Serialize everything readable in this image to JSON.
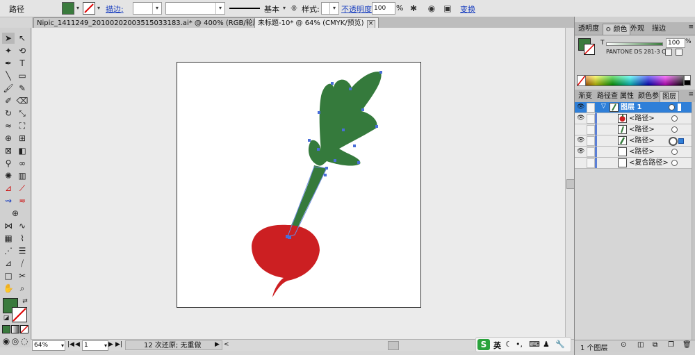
{
  "control_bar": {
    "label": "路径",
    "stroke_label": "描边:",
    "brush_label": "基本",
    "style_label": "样式:",
    "opacity_label": "不透明度:",
    "opacity_value": "100",
    "opacity_unit": "%",
    "transform_label": "变换"
  },
  "tabs": [
    {
      "label": "Nipic_1411249_20100202003515033183.ai* @ 400% (RGB/轮廓)"
    },
    {
      "label": "未标题-10* @ 64% (CMYK/预览)"
    }
  ],
  "status_bar": {
    "zoom": "64%",
    "page": "1",
    "history": "12 次还原; 无重做"
  },
  "color_panel": {
    "tabs": [
      "透明度",
      "≎ 颜色",
      "外观",
      "描边"
    ],
    "active_tab": 1,
    "tint_label": "T",
    "tint_value": "100",
    "swatch_name": "PANTONE DS 281-3 C",
    "fill_color": "#3a7a3d"
  },
  "layers_panel": {
    "tabs": [
      "渐变",
      "路径查",
      "属性",
      "颜色参",
      "图层"
    ],
    "active_tab": 4,
    "layer_name": "图层 1",
    "items": [
      {
        "name": "<路径>",
        "visible": true
      },
      {
        "name": "<路径>",
        "visible": false
      },
      {
        "name": "<路径>",
        "visible": true
      },
      {
        "name": "<路径>",
        "visible": true
      },
      {
        "name": "<复合路径>",
        "visible": false
      }
    ],
    "footer": "1 个图层"
  },
  "ime": {
    "lang": "英"
  },
  "colors": {
    "leaf_green": "#357a3c",
    "radish_red": "#cc1f22",
    "anchor_blue": "#4a6fd8",
    "selection_blue": "#2f7fd8"
  }
}
